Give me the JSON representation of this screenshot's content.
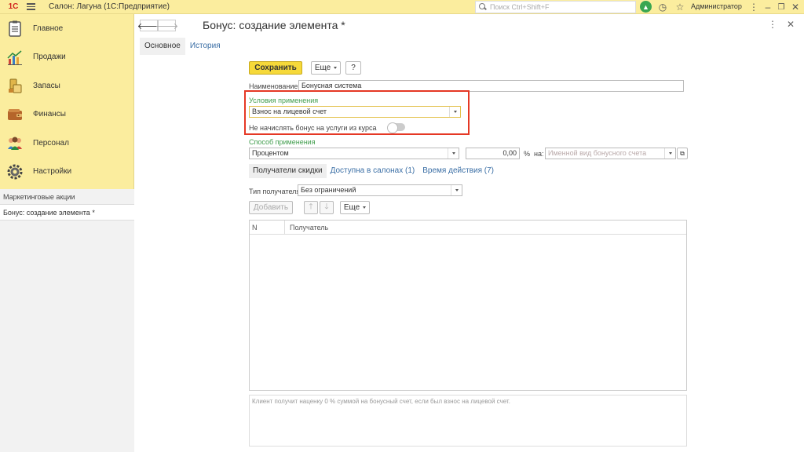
{
  "topbar": {
    "logo": "1С",
    "title": "Салон: Лагуна  (1С:Предприятие)",
    "search_placeholder": "Поиск Ctrl+Shift+F",
    "user": "Администратор"
  },
  "sidebar": {
    "items": [
      {
        "label": "Главное",
        "icon": "clipboard-icon"
      },
      {
        "label": "Продажи",
        "icon": "chart-icon"
      },
      {
        "label": "Запасы",
        "icon": "box-icon"
      },
      {
        "label": "Финансы",
        "icon": "wallet-icon"
      },
      {
        "label": "Персонал",
        "icon": "people-icon"
      },
      {
        "label": "Настройки",
        "icon": "gear-icon"
      }
    ],
    "open_windows": {
      "header": "Маркетинговые акции",
      "items": [
        "Бонус: создание элемента *"
      ]
    }
  },
  "form": {
    "title": "Бонус: создание элемента *",
    "tabs": {
      "main": "Основное",
      "history": "История"
    },
    "toolbar": {
      "save": "Сохранить",
      "more": "Еще",
      "help": "?"
    },
    "name_label": "Наименование:",
    "name_value": "Бонусная система",
    "conditions_label": "Условия применения",
    "conditions_value": "Взнос на лицевой счет",
    "no_bonus_label": "Не начислять бонус на услуги из курса",
    "method_label": "Способ применения",
    "method_value": "Процентом",
    "percent_value": "0,00",
    "percent_sign": "%",
    "on_label": "на:",
    "account_placeholder": "Именной вид бонусного счета",
    "subtabs": {
      "recipients": "Получатели скидки",
      "salons": "Доступна в салонах (1)",
      "time": "Время действия (7)"
    },
    "recipient_type_label": "Тип получателя:",
    "recipient_type_value": "Без ограничений",
    "add_button": "Добавить",
    "more2": "Еще",
    "grid": {
      "col_n": "N",
      "col_recipient": "Получатель"
    },
    "note": "Клиент получит наценку 0 % суммой на бонусный счет, если был взнос на лицевой счет."
  },
  "colors": {
    "sidebar_bg": "#fbed9e",
    "save_button": "#f6d93a",
    "highlight_box": "#e53825",
    "section_label": "#3f9c4b",
    "link": "#3a6ea5"
  }
}
